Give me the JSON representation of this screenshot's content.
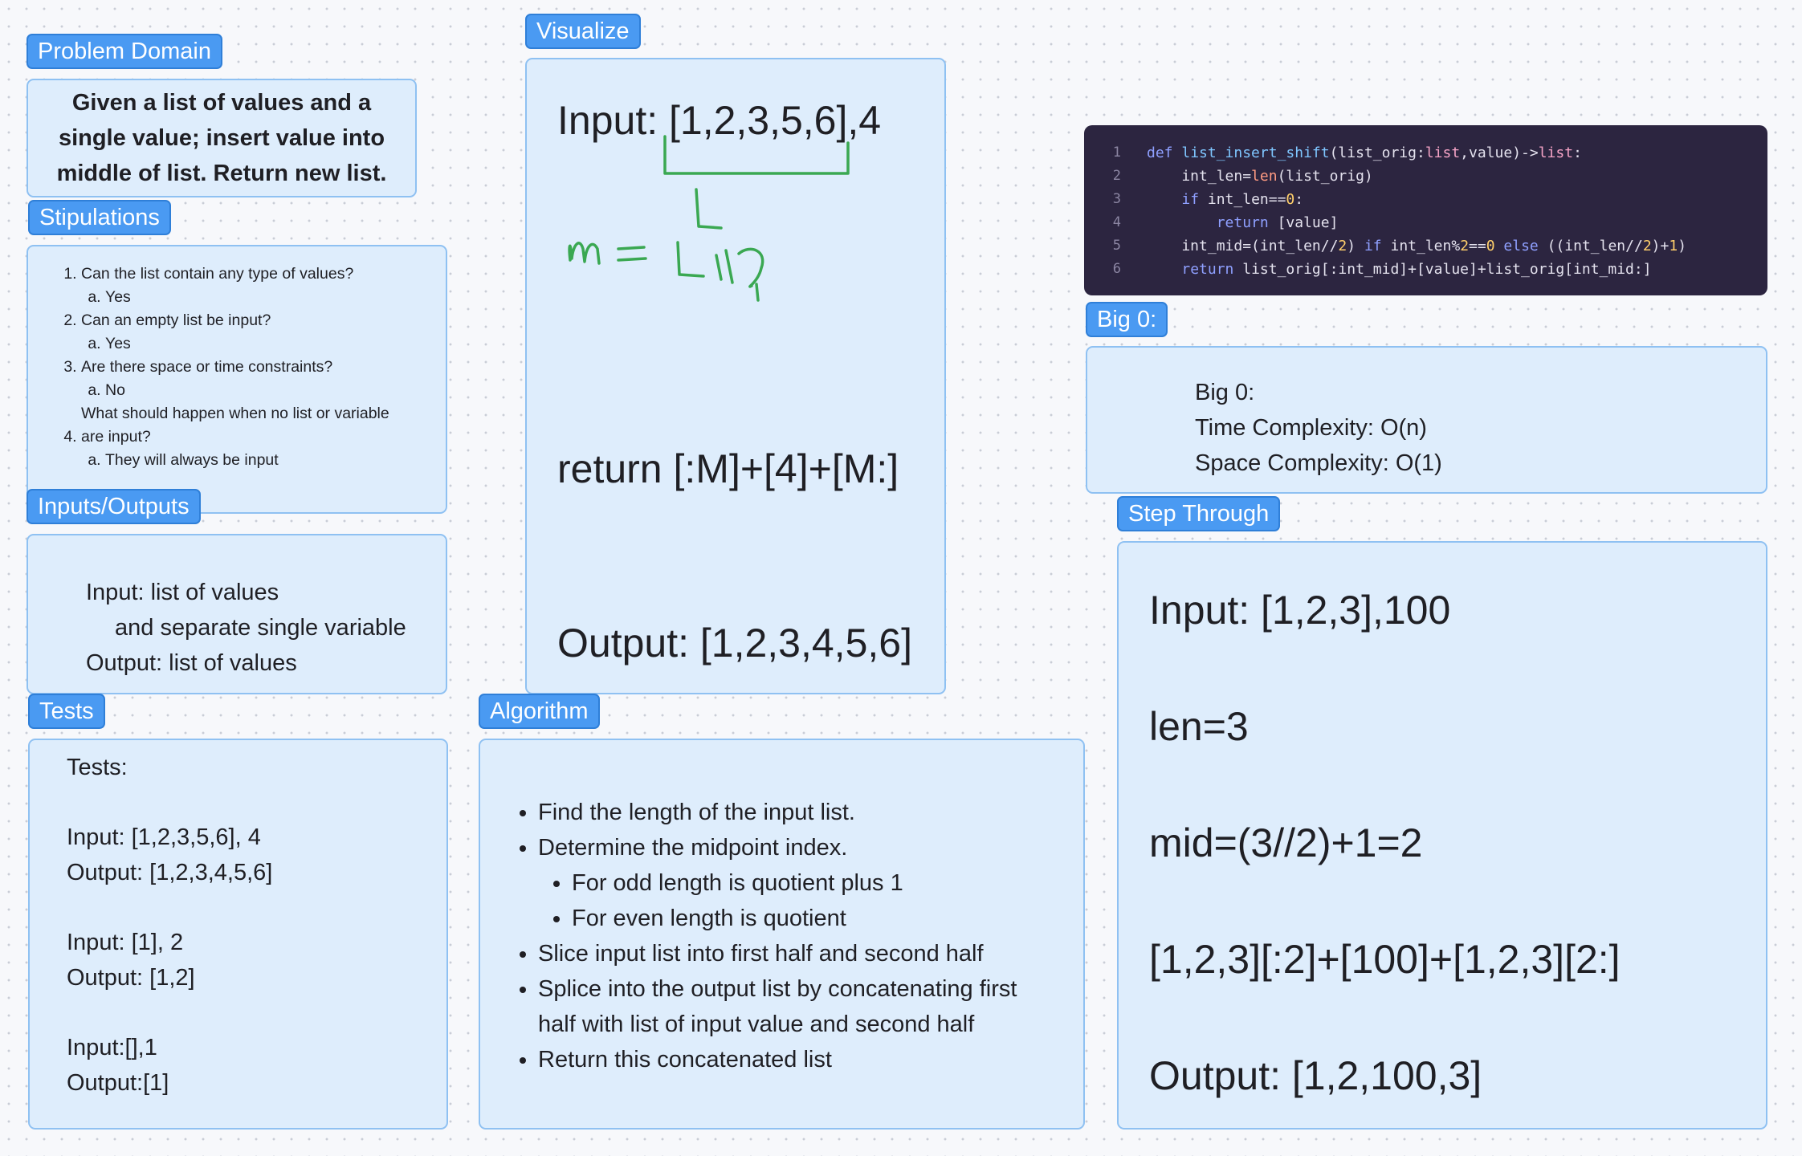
{
  "problem_domain": {
    "tag": "Problem Domain",
    "text": "Given a list of values and a single value; insert value into middle of list. Return new list."
  },
  "stipulations": {
    "tag": "Stipulations",
    "items": [
      {
        "q": "Can the list contain any type of values?",
        "a": "Yes"
      },
      {
        "q": "Can an empty list be input?",
        "a": "Yes"
      },
      {
        "q": "Are there space or time constraints?",
        "a": "No"
      },
      {
        "q": "What should happen when no list or variable are input?",
        "a": "They will always be input"
      }
    ]
  },
  "inputs_outputs": {
    "tag": "Inputs/Outputs",
    "input": "Input: list of values",
    "input_cont": "and separate single variable",
    "output": "Output: list of values"
  },
  "tests": {
    "tag": "Tests",
    "title": "Tests:",
    "cases": [
      {
        "input": "Input: [1,2,3,5,6], 4",
        "output": "Output: [1,2,3,4,5,6]"
      },
      {
        "input": "Input: [1], 2",
        "output": "Output: [1,2]"
      },
      {
        "input": "Input:[],1",
        "output": "Output:[1]"
      }
    ]
  },
  "visualize": {
    "tag": "Visualize",
    "input": "Input: [1,2,3,5,6],4",
    "handwritten": "m=L//2",
    "return": "return [:M]+[4]+[M:]",
    "output": "Output: [1,2,3,4,5,6]",
    "ink_color": "#3aa852"
  },
  "algorithm": {
    "tag": "Algorithm",
    "steps": [
      "Find the length of the input list.",
      "Determine the midpoint index.",
      "Slice input list into first half and second half",
      "Splice into the output list by concatenating first half with list of input value and second half",
      "Return this concatenated list"
    ],
    "substeps": [
      "For odd length is quotient plus 1",
      "For even length is quotient"
    ]
  },
  "code": {
    "line_numbers": [
      "1",
      "2",
      "3",
      "4",
      "5",
      "6"
    ]
  },
  "big_o": {
    "tag": "Big 0:",
    "heading": "Big 0:",
    "time": "Time Complexity: O(n)",
    "space": "Space Complexity: O(1)"
  },
  "step_through": {
    "tag": "Step Through",
    "lines": [
      "Input:  [1,2,3],100",
      "len=3",
      "mid=(3//2)+1=2",
      "[1,2,3][:2]+[100]+[1,2,3][2:]",
      "Output: [1,2,100,3]"
    ]
  },
  "colors": {
    "tag_bg": "#4a9af2",
    "card_bg": "#deedfc",
    "card_border": "#8fc1f2",
    "code_bg": "#2c2540"
  }
}
